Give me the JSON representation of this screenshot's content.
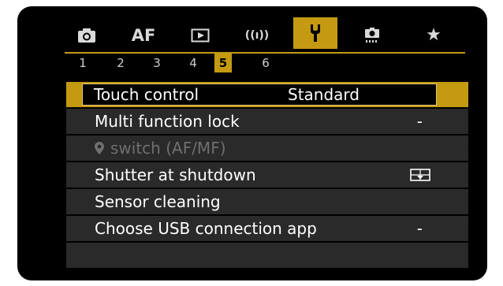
{
  "tabs": [
    {
      "name": "shooting",
      "icon": "camera-icon",
      "label": ""
    },
    {
      "name": "af",
      "icon": "",
      "label": "AF"
    },
    {
      "name": "playback",
      "icon": "play-icon",
      "label": ""
    },
    {
      "name": "wireless",
      "icon": "wireless-icon",
      "label": "((ı))"
    },
    {
      "name": "setup",
      "icon": "wrench-icon",
      "label": ""
    },
    {
      "name": "custom",
      "icon": "custom-function-icon",
      "label": ""
    },
    {
      "name": "my-menu",
      "icon": "star-icon",
      "label": "★"
    }
  ],
  "active_tab": "setup",
  "pages": [
    "1",
    "2",
    "3",
    "4",
    "5",
    "6"
  ],
  "active_page": "5",
  "menu": {
    "items": [
      {
        "label": "Touch control",
        "value": "Standard",
        "selected": true,
        "disabled": false
      },
      {
        "label": "Multi function lock",
        "value": "-",
        "selected": false,
        "disabled": false
      },
      {
        "label": "switch (AF/MF)",
        "value": "",
        "selected": false,
        "disabled": true,
        "icon": "location-pin-icon"
      },
      {
        "label": "Shutter at shutdown",
        "value": "",
        "selected": false,
        "disabled": false,
        "icon": "shutter-closed-icon"
      },
      {
        "label": "Sensor cleaning",
        "value": "",
        "selected": false,
        "disabled": false
      },
      {
        "label": "Choose USB connection app",
        "value": "-",
        "selected": false,
        "disabled": false
      },
      {
        "label": "",
        "value": "",
        "selected": false,
        "disabled": false
      }
    ]
  },
  "colors": {
    "accent": "#c49a12",
    "row_bg": "#2a2a2a",
    "background": "#000000",
    "text": "#ffffff",
    "disabled_text": "#6f6f6f"
  }
}
